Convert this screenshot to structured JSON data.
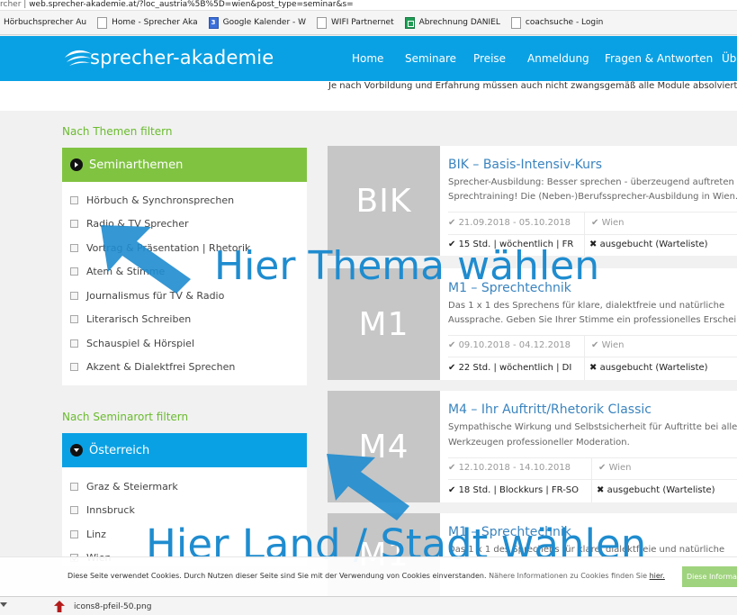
{
  "browser": {
    "url_prefix": "rcher",
    "url": "web.sprecher-akademie.at/?loc_austria%5B%5D=wien&post_type=seminar&s=",
    "bookmarks": [
      {
        "label": "Hörbuchsprecher Au",
        "icon": "folder-icon"
      },
      {
        "label": "Home - Sprecher Aka",
        "icon": "page-icon"
      },
      {
        "label": "Google Kalender - W",
        "icon": "calendar-icon"
      },
      {
        "label": "WIFI Partnernet",
        "icon": "page-icon"
      },
      {
        "label": "Abrechnung DANIEL",
        "icon": "sheet-icon"
      },
      {
        "label": "coachsuche - Login",
        "icon": "page-icon"
      }
    ]
  },
  "site": {
    "logo_text": "sprecher-akademie",
    "nav": [
      "Home",
      "Seminare",
      "Preise",
      "Anmeldung",
      "Fragen & Antworten",
      "Üb"
    ],
    "notice": "Je nach Vorbildung und Erfahrung müssen auch nicht zwangsgemäß alle Module absolviert werde"
  },
  "sidebar": {
    "theme_filter_title": "Nach Themen filtern",
    "theme_panel_title": "Seminarthemen",
    "themes": [
      "Hörbuch & Synchronsprechen",
      "Radio & TV Sprecher",
      "Vortrag & Präsentation | Rhetorik",
      "Atem & Stimme",
      "Journalismus für TV & Radio",
      "Literarisch Schreiben",
      "Schauspiel & Hörspiel",
      "Akzent & Dialektfrei Sprechen"
    ],
    "location_filter_title": "Nach Seminarort filtern",
    "location_panel_title": "Österreich",
    "locations": [
      {
        "label": "Graz & Steiermark",
        "checked": false
      },
      {
        "label": "Innsbruck",
        "checked": false
      },
      {
        "label": "Linz",
        "checked": false
      },
      {
        "label": "Wien",
        "checked": true
      }
    ]
  },
  "courses": [
    {
      "code": "BIK",
      "title": "BIK – Basis-Intensiv-Kurs",
      "desc1": "Sprecher-Ausbildung: Besser sprechen - überzeugend auftreten - Da",
      "desc2": "Sprechtraining! Die (Neben-)Berufssprecher-Ausbildung in Wien.",
      "dates": "21.09.2018 - 05.10.2018",
      "location": "Wien",
      "hours": "15 Std. | wöchentlich | FR",
      "status": "ausgebucht (Warteliste)"
    },
    {
      "code": "M1",
      "title": "M1 – Sprechtechnik",
      "desc1": "Das 1 x 1 des Sprechens für klare, dialektfreie und natürliche",
      "desc2": "Aussprache. Geben Sie Ihrer Stimme ein professionelles Erscheinen",
      "dates": "09.10.2018 - 04.12.2018",
      "location": "Wien",
      "hours": "22 Std. | wöchentlich | DI",
      "status": "ausgebucht (Warteliste)"
    },
    {
      "code": "M4",
      "title": "M4 – Ihr Auftritt/Rhetorik Classic",
      "desc1": "Sympathische Wirkung und Selbstsicherheit für Auftritte bei allen A",
      "desc2": "Werkzeugen professioneller Moderation.",
      "dates": "12.10.2018 - 14.10.2018",
      "location": "Wien",
      "hours": "18 Std. | Blockkurs | FR-SO",
      "status": "ausgebucht (Warteliste)"
    },
    {
      "code": "M1",
      "title": "M1 – Sprechtechnik",
      "desc1": "Das 1 x 1 des Sprechens für klare, dialektfreie und natürliche",
      "desc2": "",
      "dates": "",
      "location": "",
      "hours": "",
      "status": ""
    }
  ],
  "annotations": {
    "theme_hint": "Hier Thema wählen",
    "location_hint": "Hier Land / Stadt wählen"
  },
  "cookie": {
    "text": "Diese Seite verwendet Cookies. Durch Nutzen dieser Seite sind Sie mit der Verwendung von Cookies einverstanden.",
    "more": "Nähere Informationen zu Cookies finden Sie",
    "link": "hier.",
    "button": "Diese Informationen"
  },
  "download": {
    "file": "icons8-pfeil-50.png"
  },
  "colors": {
    "brand_blue": "#0aa1e4",
    "green": "#80c341",
    "overlay_blue": "#1f8ccf",
    "thumb_grey": "#c6c6c6"
  }
}
